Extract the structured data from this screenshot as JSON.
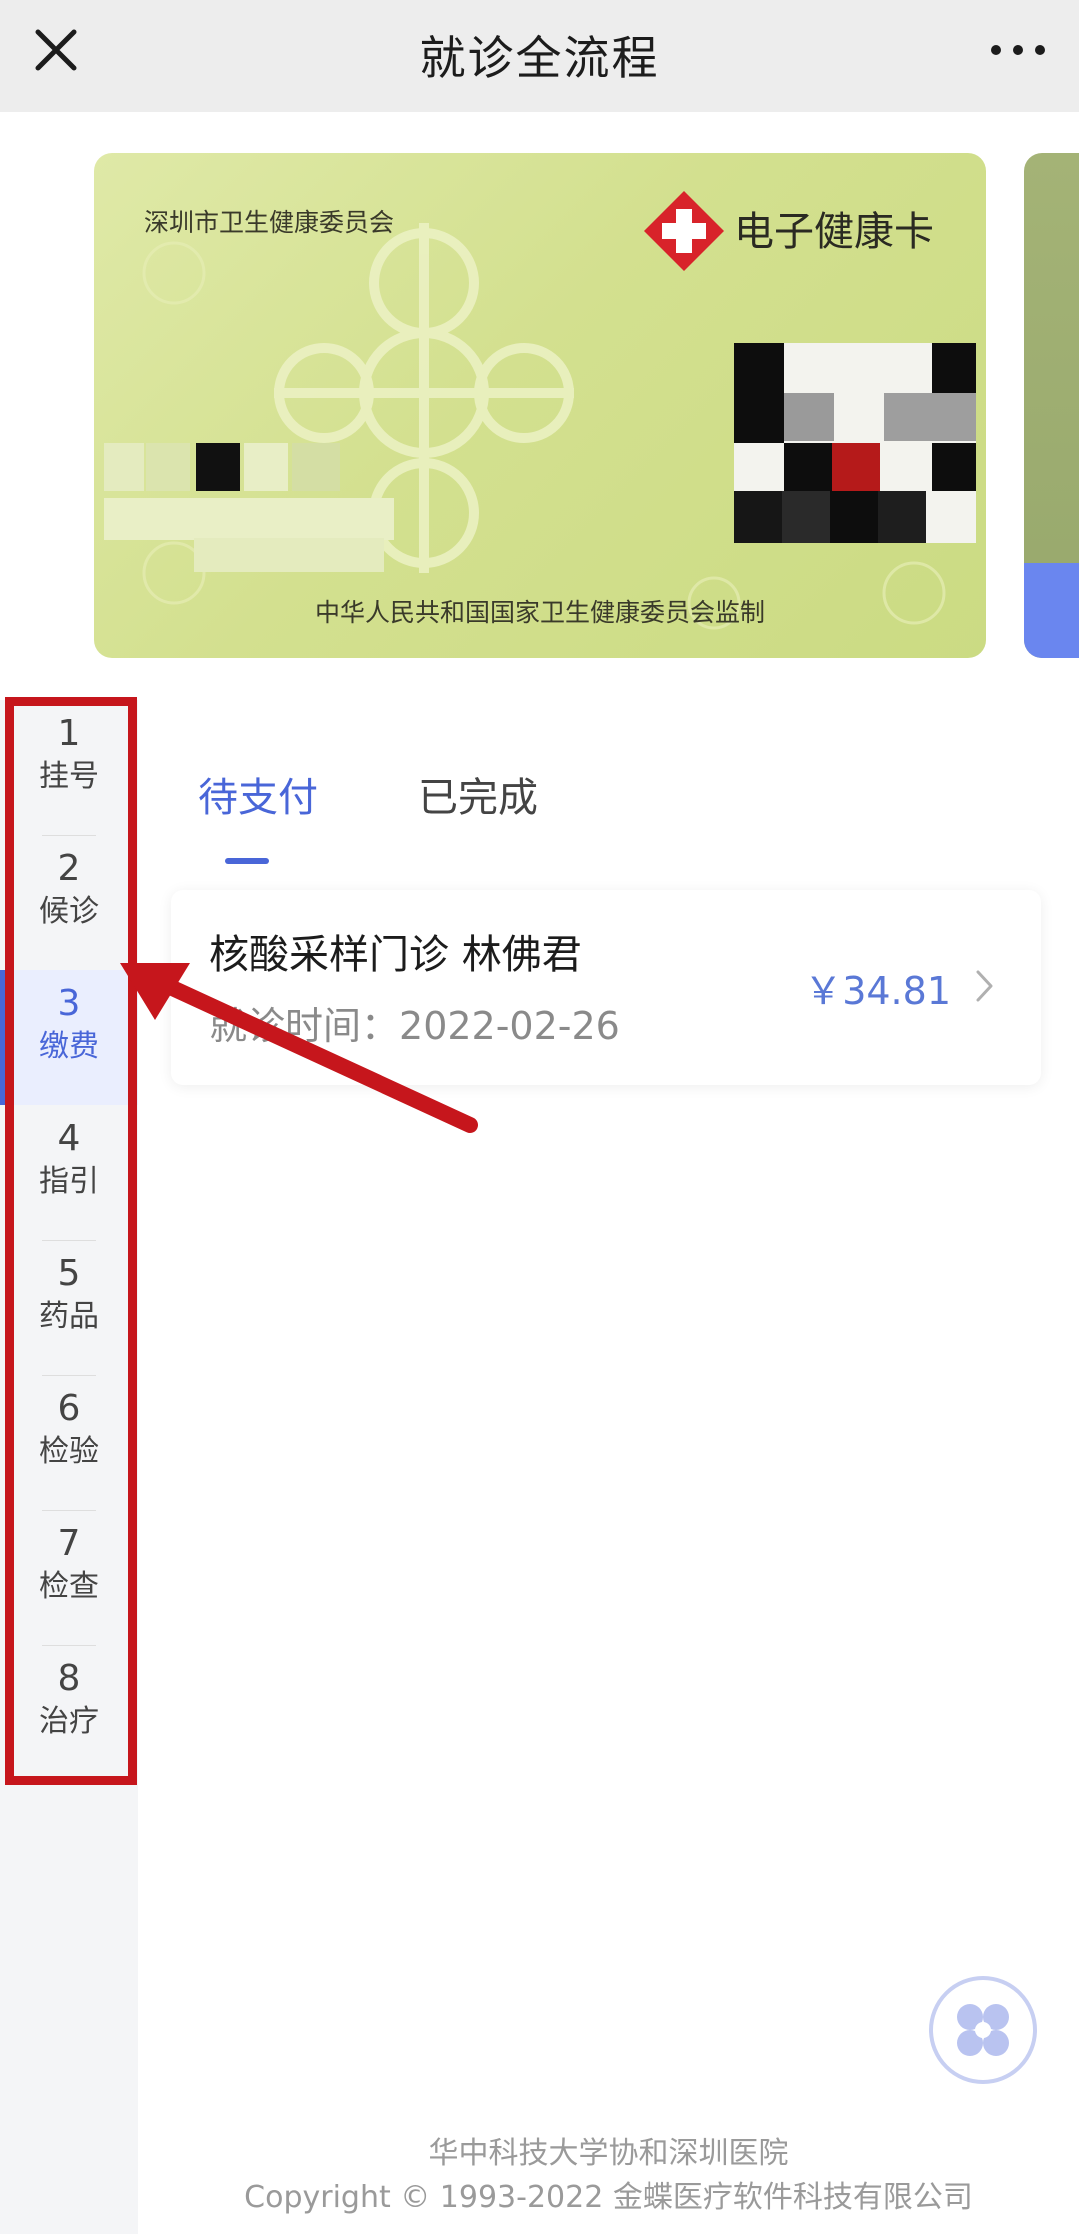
{
  "header": {
    "title": "就诊全流程"
  },
  "health_card": {
    "issuer": "深圳市卫生健康委员会",
    "card_title": "电子健康卡",
    "supervisor": "中华人民共和国国家卫生健康委员会监制"
  },
  "steps": [
    {
      "num": "1",
      "label": "挂号",
      "active": false
    },
    {
      "num": "2",
      "label": "候诊",
      "active": false
    },
    {
      "num": "3",
      "label": "缴费",
      "active": true
    },
    {
      "num": "4",
      "label": "指引",
      "active": false
    },
    {
      "num": "5",
      "label": "药品",
      "active": false
    },
    {
      "num": "6",
      "label": "检验",
      "active": false
    },
    {
      "num": "7",
      "label": "检查",
      "active": false
    },
    {
      "num": "8",
      "label": "治疗",
      "active": false
    }
  ],
  "tabs": {
    "pending": "待支付",
    "done": "已完成"
  },
  "order": {
    "name": "核酸采样门诊  林佛君",
    "time_label": "就诊时间：",
    "time_value": "2022-02-26",
    "price": "￥34.81"
  },
  "footer": {
    "hospital": "华中科技大学协和深圳医院",
    "copyright": "Copyright © 1993-2022 金蝶医疗软件科技有限公司"
  },
  "colors": {
    "accent": "#4966d8",
    "annotation_red": "#c6161c",
    "card_green": "#d3e08f"
  }
}
